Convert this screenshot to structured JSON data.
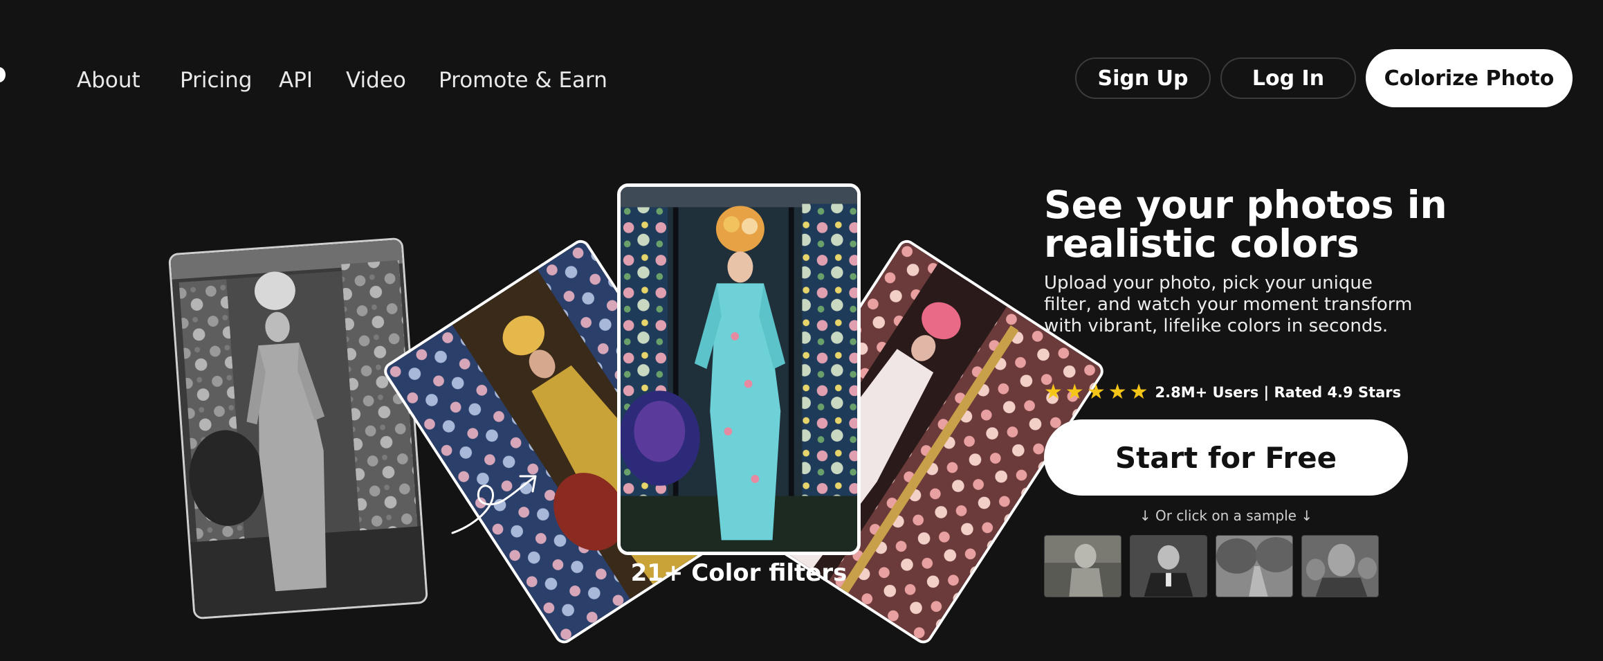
{
  "nav": {
    "links": [
      "About",
      "Pricing",
      "API",
      "Video",
      "Promote & Earn"
    ]
  },
  "auth": {
    "signup": "Sign Up",
    "login": "Log In",
    "colorize": "Colorize Photo"
  },
  "hero": {
    "title": "See your photos in realistic colors",
    "subtitle": "Upload your photo, pick your unique filter, and watch your moment transform with vibrant, lifelike colors in seconds.",
    "stars": 5,
    "rating_text": "2.8M+ Users | Rated 4.9 Stars",
    "cta": "Start for Free",
    "sample_hint": "↓ Or click on a sample ↓",
    "filters_label": "21+ Color filters"
  },
  "colors": {
    "background": "#141314",
    "star": "#f5c518",
    "button": "#ffffff"
  },
  "icons": {
    "arrow": "curly-arrow-icon",
    "star": "star-icon"
  }
}
